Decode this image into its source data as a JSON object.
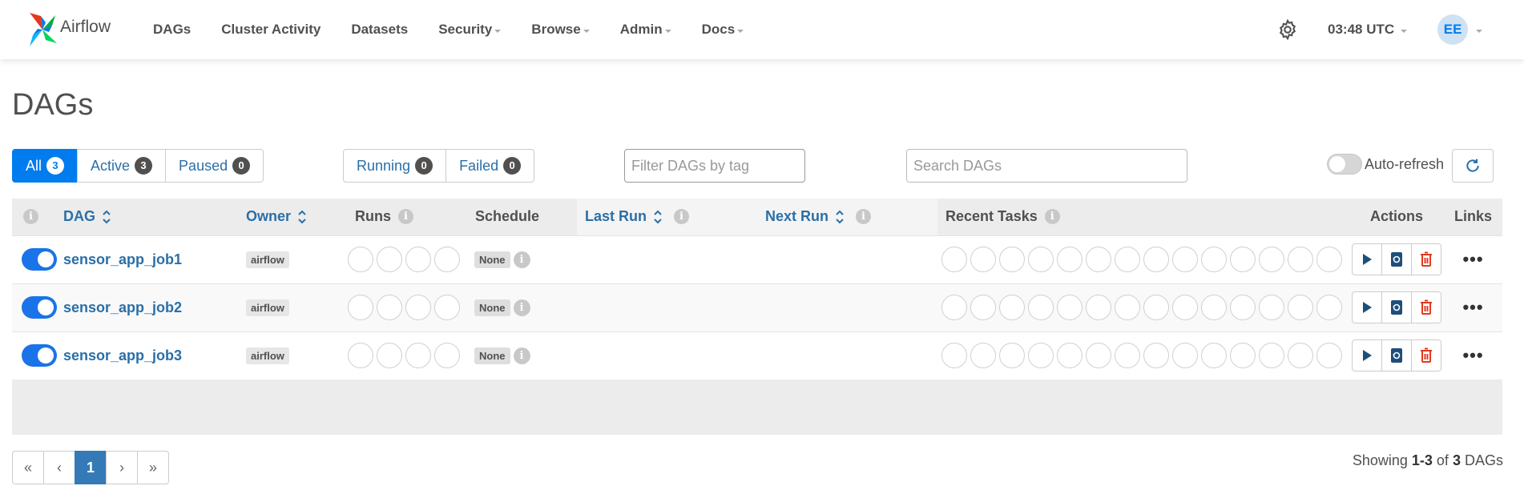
{
  "navbar": {
    "brand": "Airflow",
    "items": [
      {
        "label": "DAGs",
        "dropdown": false
      },
      {
        "label": "Cluster Activity",
        "dropdown": false
      },
      {
        "label": "Datasets",
        "dropdown": false
      },
      {
        "label": "Security",
        "dropdown": true
      },
      {
        "label": "Browse",
        "dropdown": true
      },
      {
        "label": "Admin",
        "dropdown": true
      },
      {
        "label": "Docs",
        "dropdown": true
      }
    ],
    "time": "03:48 UTC",
    "user_initials": "EE"
  },
  "page": {
    "title": "DAGs"
  },
  "filters": {
    "status": [
      {
        "label": "All",
        "count": "3",
        "active": true
      },
      {
        "label": "Active",
        "count": "3",
        "active": false
      },
      {
        "label": "Paused",
        "count": "0",
        "active": false
      }
    ],
    "state": [
      {
        "label": "Running",
        "count": "0"
      },
      {
        "label": "Failed",
        "count": "0"
      }
    ],
    "tag_placeholder": "Filter DAGs by tag",
    "search_placeholder": "Search DAGs",
    "autorefresh_label": "Auto-refresh"
  },
  "table": {
    "headers": {
      "dag": "DAG",
      "owner": "Owner",
      "runs": "Runs",
      "schedule": "Schedule",
      "last_run": "Last Run",
      "next_run": "Next Run",
      "recent_tasks": "Recent Tasks",
      "actions": "Actions",
      "links": "Links"
    },
    "rows": [
      {
        "dag_id": "sensor_app_job1",
        "owner": "airflow",
        "schedule": "None"
      },
      {
        "dag_id": "sensor_app_job2",
        "owner": "airflow",
        "schedule": "None"
      },
      {
        "dag_id": "sensor_app_job3",
        "owner": "airflow",
        "schedule": "None"
      }
    ]
  },
  "pagination": {
    "first": "«",
    "prev": "‹",
    "current": "1",
    "next": "›",
    "last": "»"
  },
  "showing": {
    "prefix": "Showing",
    "range": "1-3",
    "of": "of",
    "total": "3",
    "suffix": "DAGs"
  },
  "colors": {
    "accent": "#017cee",
    "link": "#2a6fa8",
    "delete": "#e43921"
  }
}
